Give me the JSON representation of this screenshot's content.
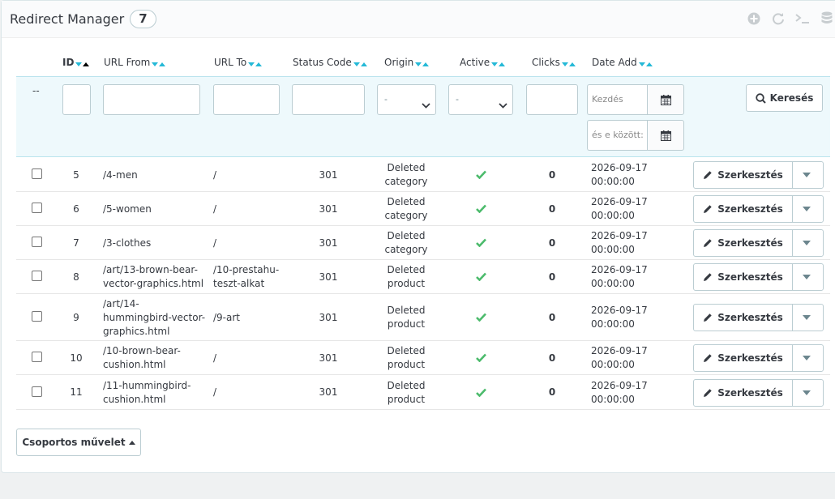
{
  "header": {
    "title": "Redirect Manager",
    "count": "7",
    "toolbar_icons": [
      "add-icon",
      "refresh-icon",
      "terminal-icon",
      "database-icon"
    ]
  },
  "columns": {
    "id": "ID",
    "url_from": "URL From",
    "url_to": "URL To",
    "status_code": "Status Code",
    "origin": "Origin",
    "active": "Active",
    "clicks": "Clicks",
    "date_add": "Date Add"
  },
  "filters": {
    "bulk_placeholder": "--",
    "origin_selected": "-",
    "active_selected": "-",
    "date_from_placeholder": "Kezdés",
    "date_to_placeholder": "és e között:",
    "search_label": "Keresés"
  },
  "rows": [
    {
      "id": "5",
      "from": [
        "/4-men"
      ],
      "to": [
        "/"
      ],
      "status": "301",
      "origin": [
        "Deleted",
        "category"
      ],
      "clicks": "0",
      "date": [
        "2026-09-17",
        "00:00:00"
      ]
    },
    {
      "id": "6",
      "from": [
        "/5-women"
      ],
      "to": [
        "/"
      ],
      "status": "301",
      "origin": [
        "Deleted",
        "category"
      ],
      "clicks": "0",
      "date": [
        "2026-09-17",
        "00:00:00"
      ]
    },
    {
      "id": "7",
      "from": [
        "/3-clothes"
      ],
      "to": [
        "/"
      ],
      "status": "301",
      "origin": [
        "Deleted",
        "category"
      ],
      "clicks": "0",
      "date": [
        "2026-09-17",
        "00:00:00"
      ]
    },
    {
      "id": "8",
      "from": [
        "/art/13-brown-bear-",
        "vector-graphics.html"
      ],
      "to": [
        "/10-prestahu-",
        "teszt-alkat"
      ],
      "status": "301",
      "origin": [
        "Deleted",
        "product"
      ],
      "clicks": "0",
      "date": [
        "2026-09-17",
        "00:00:00"
      ]
    },
    {
      "id": "9",
      "from": [
        "/art/14-",
        "hummingbird-vector-",
        "graphics.html"
      ],
      "to": [
        "/9-art"
      ],
      "status": "301",
      "origin": [
        "Deleted",
        "product"
      ],
      "clicks": "0",
      "date": [
        "2026-09-17",
        "00:00:00"
      ]
    },
    {
      "id": "10",
      "from": [
        "/10-brown-bear-",
        "cushion.html"
      ],
      "to": [
        "/"
      ],
      "status": "301",
      "origin": [
        "Deleted",
        "product"
      ],
      "clicks": "0",
      "date": [
        "2026-09-17",
        "00:00:00"
      ]
    },
    {
      "id": "11",
      "from": [
        "/11-hummingbird-",
        "cushion.html"
      ],
      "to": [
        "/"
      ],
      "status": "301",
      "origin": [
        "Deleted",
        "product"
      ],
      "clicks": "0",
      "date": [
        "2026-09-17",
        "00:00:00"
      ]
    }
  ],
  "row_actions": {
    "edit_label": "Szerkesztés"
  },
  "bulk": {
    "label": "Csoportos művelet"
  },
  "colors": {
    "accent": "#25b9d7",
    "success": "#4cbb6c",
    "border": "#bbcdd2"
  }
}
